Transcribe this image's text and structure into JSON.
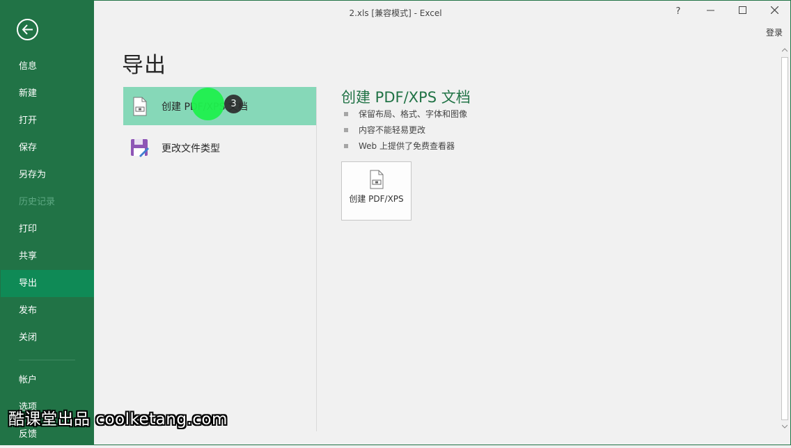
{
  "window": {
    "title": "2.xls  [兼容模式] - Excel",
    "help_label": "?",
    "minimize_label": "—",
    "close_label": "✕",
    "signin_label": "登录"
  },
  "sidebar": {
    "items": [
      {
        "label": "信息"
      },
      {
        "label": "新建"
      },
      {
        "label": "打开"
      },
      {
        "label": "保存"
      },
      {
        "label": "另存为"
      },
      {
        "label": "历史记录"
      },
      {
        "label": "打印"
      },
      {
        "label": "共享"
      },
      {
        "label": "导出"
      },
      {
        "label": "发布"
      },
      {
        "label": "关闭"
      },
      {
        "label": "帐户"
      },
      {
        "label": "选项"
      },
      {
        "label": "反馈"
      }
    ]
  },
  "main": {
    "title": "导出",
    "options": [
      {
        "label": "创建 PDF/XPS 文档"
      },
      {
        "label": "更改文件类型"
      }
    ],
    "detail": {
      "title": "创建 PDF/XPS 文档",
      "bullets": [
        "保留布局、格式、字体和图像",
        "内容不能轻易更改",
        "Web 上提供了免费查看器"
      ],
      "button_label": "创建 PDF/XPS"
    }
  },
  "overlay": {
    "step_number": "3",
    "watermark": "酷课堂出品 coolketang.com"
  },
  "colors": {
    "sidebar_bg": "#217346",
    "sidebar_active": "#0f8a56",
    "selected_option": "#86d8b8",
    "accent": "#217346"
  }
}
